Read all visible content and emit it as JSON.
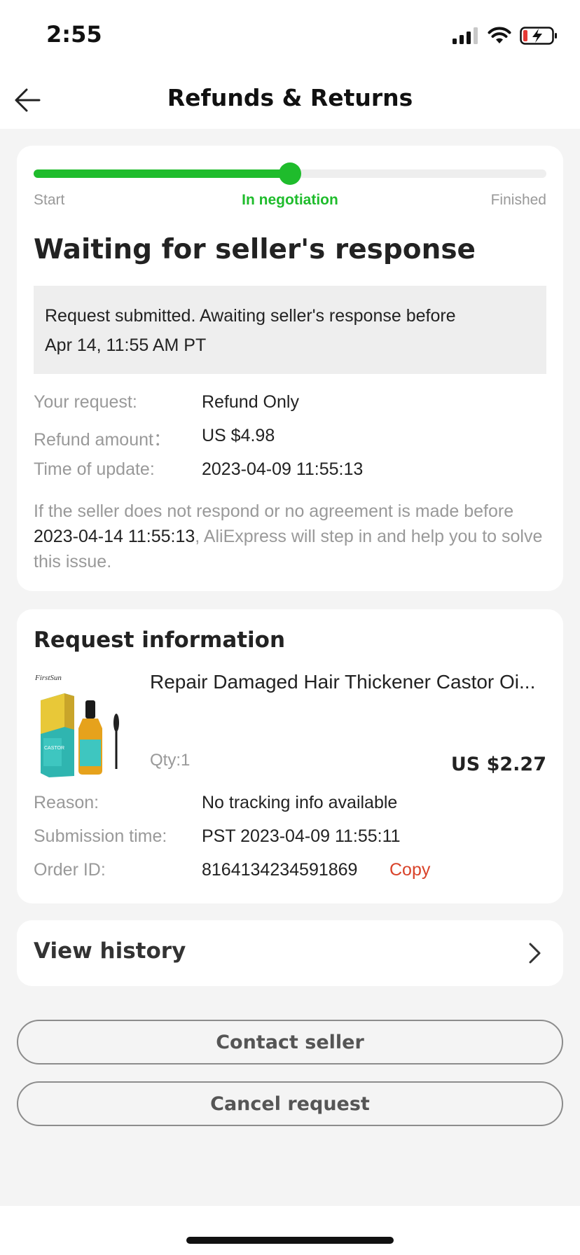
{
  "status_bar": {
    "time": "2:55"
  },
  "nav": {
    "title": "Refunds & Returns"
  },
  "progress": {
    "steps": [
      "Start",
      "In negotiation",
      "Finished"
    ],
    "fraction": 0.5,
    "accent_color": "#1fbc2c"
  },
  "status": {
    "title": "Waiting for seller's response",
    "notice_line1": "Request submitted. Awaiting seller's response before",
    "notice_line2": "Apr 14, 11:55 AM PT",
    "details": [
      {
        "label": "Your request:",
        "value": "Refund Only"
      },
      {
        "label": "Refund amount：",
        "value": "US $4.98"
      },
      {
        "label": "Time of update:",
        "value": "2023-04-09 11:55:13"
      }
    ],
    "footnote_prefix": "If the seller does not respond or no agreement is made before ",
    "footnote_date": "2023-04-14 11:55:13",
    "footnote_suffix": ", AliExpress will step in and help you to solve this issue."
  },
  "request": {
    "title": "Request information",
    "product": {
      "brand": "FirstSun",
      "box_label": "CASTOR",
      "name": "Repair Damaged Hair Thickener Castor Oi...",
      "qty": "Qty:1",
      "price": "US $2.27"
    },
    "details": [
      {
        "label": "Reason:",
        "value": "No tracking info available"
      },
      {
        "label": "Submission time:",
        "value": "PST 2023-04-09 11:55:11"
      },
      {
        "label": "Order ID:",
        "value": "8164134234591869"
      }
    ],
    "copy_label": "Copy"
  },
  "history": {
    "label": "View history"
  },
  "buttons": {
    "contact": "Contact seller",
    "cancel": "Cancel request"
  },
  "colors": {
    "link": "#d9432a",
    "battery_low": "#e53935"
  }
}
